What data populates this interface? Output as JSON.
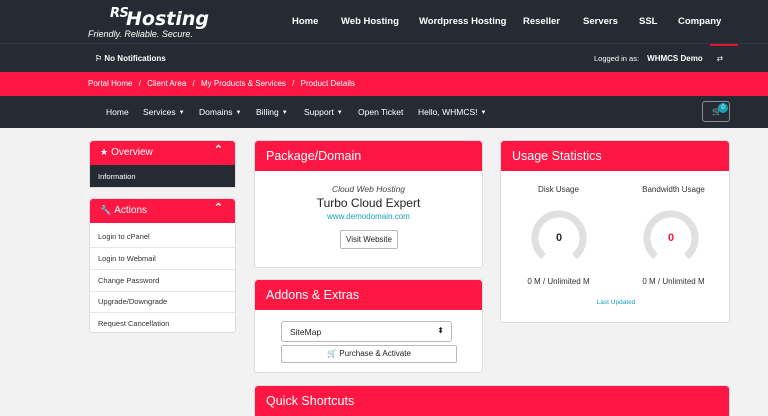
{
  "brand": {
    "logo_rs": "RS",
    "logo_hosting": "Hosting",
    "tagline": "Friendly. Reliable. Secure."
  },
  "topnav": [
    "Home",
    "Web Hosting",
    "Wordpress Hosting",
    "Reseller",
    "Servers",
    "SSL",
    "Company"
  ],
  "notifications": {
    "label": "No Notifications"
  },
  "user": {
    "logged_in_label": "Logged in as:",
    "name": "WHMCS Demo"
  },
  "breadcrumb": [
    "Portal Home",
    "Client Area",
    "My Products & Services",
    "Product Details"
  ],
  "breadcrumb_sep": "/",
  "mainnav": [
    {
      "label": "Home",
      "dropdown": false
    },
    {
      "label": "Services",
      "dropdown": true
    },
    {
      "label": "Domains",
      "dropdown": true
    },
    {
      "label": "Billing",
      "dropdown": true
    },
    {
      "label": "Support",
      "dropdown": true
    },
    {
      "label": "Open Ticket",
      "dropdown": false
    },
    {
      "label": "Hello, WHMCS!",
      "dropdown": true
    }
  ],
  "cart": {
    "count": "0"
  },
  "sidebar": {
    "overview": {
      "title": "Overview",
      "items": [
        "Information"
      ]
    },
    "actions": {
      "title": "Actions",
      "items": [
        "Login to cPanel",
        "Login to Webmail",
        "Change Password",
        "Upgrade/Downgrade",
        "Request Cancellation"
      ]
    }
  },
  "package": {
    "title": "Package/Domain",
    "group": "Cloud Web Hosting",
    "name": "Turbo Cloud Expert",
    "domain": "www.demodomain.com",
    "visit_label": "Visit Website"
  },
  "addons": {
    "title": "Addons & Extras",
    "select_value": "SiteMap",
    "purchase_label": "Purchase & Activate"
  },
  "usage": {
    "title": "Usage Statistics",
    "disk": {
      "label": "Disk Usage",
      "value": "0",
      "detail": "0 M / Unlimited M",
      "color": "#262b33"
    },
    "bandwidth": {
      "label": "Bandwidth Usage",
      "value": "0",
      "detail": "0 M / Unlimited M",
      "color": "#ff1744"
    },
    "last_updated": "Last Updated"
  },
  "shortcuts": {
    "title": "Quick Shortcuts"
  },
  "colors": {
    "accent": "#ff1744",
    "dark": "#262b33",
    "link": "#17a2b8"
  }
}
